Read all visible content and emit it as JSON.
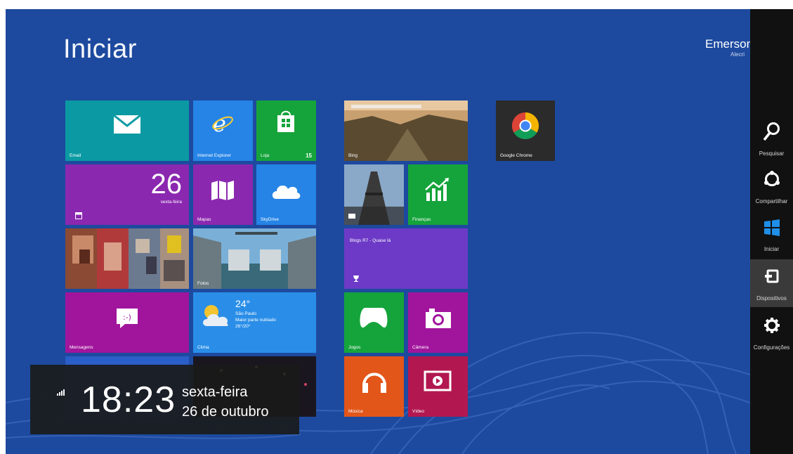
{
  "start": {
    "title": "Iniciar"
  },
  "user": {
    "name": "Emerson",
    "subtitle": "Alecri"
  },
  "tiles": {
    "email": "Email",
    "ie": "Internet Explorer",
    "store": "Loja",
    "store_count": "15",
    "bing": "Bing",
    "chrome": "Google Chrome",
    "calendar_day": "26",
    "calendar_weekday": "sexta-feira",
    "maps": "Mapas",
    "skydrive": "SkyDrive",
    "finance": "Finanças",
    "games_tile": "Blogs R7 - Quase lá",
    "people": "",
    "photos": "Fotos",
    "messaging": "Mensagens",
    "weather_temp": "24°",
    "weather_city": "São Paulo",
    "weather_desc": "Maior parte nublado",
    "weather_range": "26°/20°",
    "weather": "Clima",
    "xbox": "Jogos",
    "camera": "Câmera",
    "music": "Música",
    "video": "Vídeo"
  },
  "charms": [
    {
      "label": "Pesquisar",
      "icon": "search-icon"
    },
    {
      "label": "Compartilhar",
      "icon": "share-icon"
    },
    {
      "label": "Iniciar",
      "icon": "windows-icon"
    },
    {
      "label": "Dispositivos",
      "icon": "devices-icon"
    },
    {
      "label": "Configurações",
      "icon": "gear-icon"
    }
  ],
  "clock": {
    "time": "18:23",
    "day": "sexta-feira",
    "date": "26 de outubro"
  },
  "colors": {
    "background": "#1d4a9f",
    "teal": "#0b9aa3",
    "blue": "#2584e6",
    "green": "#15a43b",
    "purple": "#8b28b0",
    "violet": "#6c3ac6",
    "orange": "#e2561a",
    "crimson": "#b2184f",
    "charms_bar": "#111111"
  }
}
